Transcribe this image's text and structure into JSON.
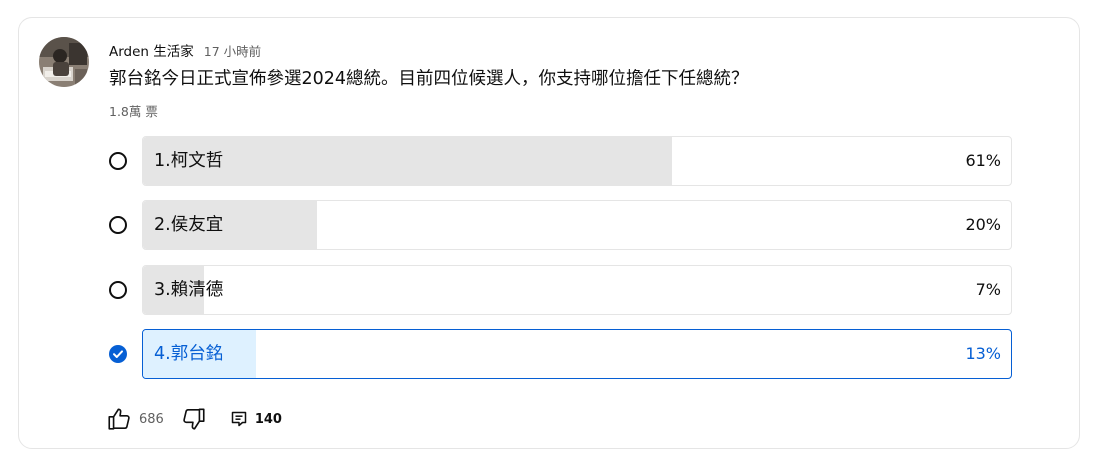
{
  "post": {
    "author": "Arden 生活家",
    "time": "17 小時前",
    "question": "郭台銘今日正式宣佈參選2024總統。目前四位候選人，你支持哪位擔任下任總統？",
    "vote_count": "1.8萬 票"
  },
  "poll": {
    "options": [
      {
        "label": "1.柯文哲",
        "percent": "61%",
        "fill": 0.61,
        "selected": false
      },
      {
        "label": "2.侯友宜",
        "percent": "20%",
        "fill": 0.2,
        "selected": false
      },
      {
        "label": "3.賴清德",
        "percent": "7%",
        "fill": 0.07,
        "selected": false
      },
      {
        "label": "4.郭台銘",
        "percent": "13%",
        "fill": 0.13,
        "selected": true
      }
    ]
  },
  "actions": {
    "like_count": "686",
    "comment_count": "140",
    "like_icon": "thumbs-up-icon",
    "dislike_icon": "thumbs-down-icon",
    "comment_icon": "comment-icon"
  },
  "colors": {
    "accent": "#065fd4",
    "selected_fill": "#def1ff",
    "option_fill": "#e5e5e5",
    "secondary_text": "#606060"
  }
}
